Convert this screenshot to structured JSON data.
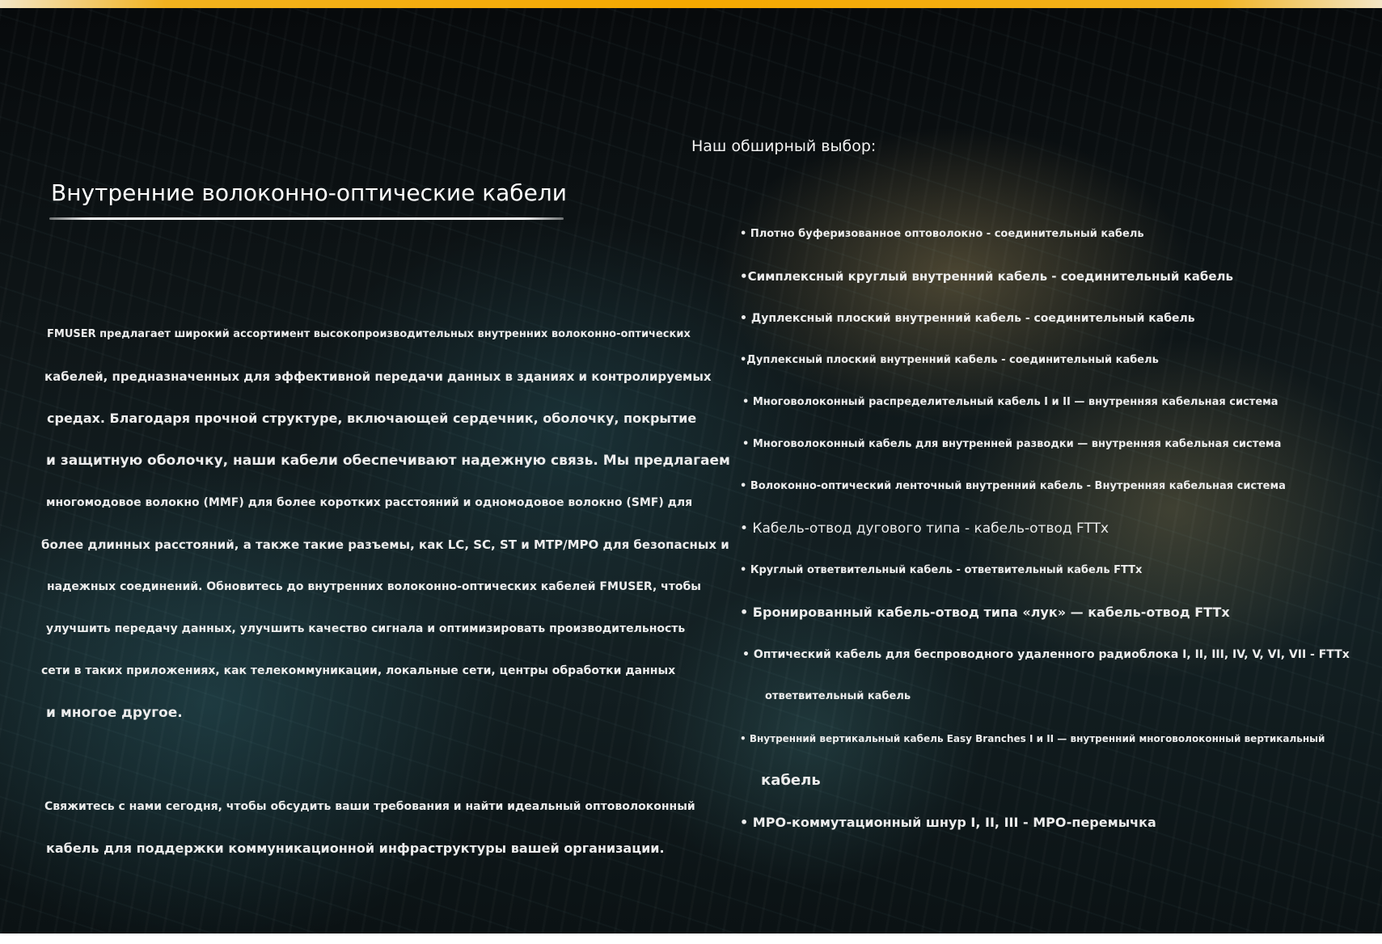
{
  "left": {
    "heading": "Внутренние волоконно-оптические кабели",
    "paragraph1": [
      "FMUSER предлагает широкий ассортимент высокопроизводительных внутренних волоконно-оптических",
      "кабелей, предназначенных для эффективной передачи данных в зданиях и контролируемых",
      "средах. Благодаря прочной структуре, включающей сердечник, оболочку, покрытие",
      "и защитную оболочку, наши кабели обеспечивают надежную связь. Мы предлагаем",
      "многомодовое волокно (MMF) для более коротких расстояний и одномодовое волокно (SMF) для",
      "более длинных расстояний, а также такие разъемы, как LC, SC, ST и MTP/MPO для безопасных и",
      "надежных соединений. Обновитесь до внутренних волоконно-оптических кабелей FMUSER, чтобы",
      "улучшить передачу данных, улучшить качество сигнала и оптимизировать производительность",
      "сети в таких приложениях, как телекоммуникации, локальные сети, центры обработки данных",
      "и многое другое."
    ],
    "paragraph2": [
      "Свяжитесь с нами сегодня, чтобы обсудить ваши требования и найти идеальный оптоволоконный",
      "кабель для поддержки коммуникационной инфраструктуры вашей организации."
    ]
  },
  "right": {
    "title": "Наш обширный выбор:",
    "items": [
      "• Плотно буферизованное оптоволокно - соединительный кабель",
      "•Симплексный круглый внутренний кабель - соединительный кабель",
      "• Дуплексный плоский внутренний кабель - соединительный кабель",
      "•Дуплексный плоский внутренний кабель - соединительный кабель",
      "• Многоволоконный распределительный кабель I и II — внутренняя кабельная система",
      "• Многоволоконный кабель для внутренней разводки — внутренняя кабельная система",
      "• Волоконно-оптический ленточный внутренний кабель - Внутренняя кабельная система",
      "• Кабель-отвод дугового типа - кабель-отвод FTTx",
      "• Круглый ответвительный кабель - ответвительный кабель FTTx",
      "• Бронированный кабель-отвод типа «лук» — кабель-отвод FTTx",
      "• Оптический кабель для беспроводного удаленного радиоблока I, II, III, IV, V, VI, VII - FTTx",
      "ответвительный кабель",
      "• Внутренний вертикальный кабель Easy Branches I и II — внутренний многоволоконный вертикальный",
      "кабель",
      "• MPO-коммутационный шнур I, II, III - MPO-перемычка"
    ]
  }
}
